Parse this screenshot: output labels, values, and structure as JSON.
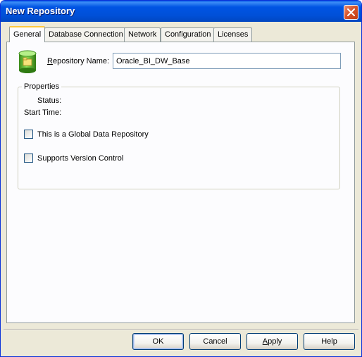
{
  "window": {
    "title": "New Repository"
  },
  "tabs": [
    {
      "label": "General",
      "active": true
    },
    {
      "label": "Database Connection",
      "active": false
    },
    {
      "label": "Network",
      "active": false
    },
    {
      "label": "Configuration",
      "active": false
    },
    {
      "label": "Licenses",
      "active": false
    }
  ],
  "general": {
    "repo_name_label": "Repository Name:",
    "repo_name_label_accesskey": "R",
    "repo_name_label_rest": "epository Name:",
    "repo_name_value": "Oracle_BI_DW_Base",
    "properties": {
      "legend": "Properties",
      "status_label": "Status:",
      "start_time_label": "Start Time:"
    },
    "checkboxes": [
      {
        "label": "This is a Global Data Repository",
        "checked": false
      },
      {
        "label": "Supports Version Control",
        "checked": false
      }
    ]
  },
  "buttons": {
    "ok": "OK",
    "cancel": "Cancel",
    "apply_accesskey": "A",
    "apply_rest": "pply",
    "help": "Help"
  },
  "icons": {
    "close": "close-icon",
    "repository": "repository-database-icon"
  },
  "colors": {
    "titlebar": "#0054e3",
    "dialog_bg": "#ece9d8",
    "panel_bg": "#fcfcfe",
    "tab_highlight": "#ffc83c",
    "close_button": "#d6542c"
  }
}
